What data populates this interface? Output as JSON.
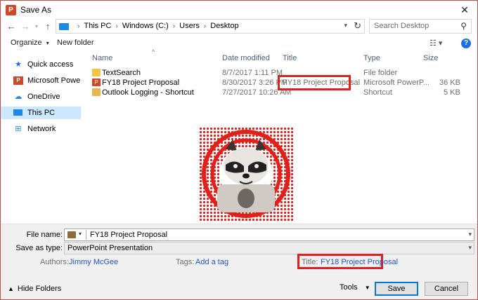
{
  "window": {
    "title": "Save As",
    "app_icon_letter": "P"
  },
  "address": {
    "crumbs": [
      "This PC",
      "Windows (C:)",
      "Users",
      "Desktop"
    ],
    "search_placeholder": "Search Desktop"
  },
  "toolbar": {
    "organize": "Organize",
    "new_folder": "New folder"
  },
  "sidebar": {
    "items": [
      {
        "label": "Quick access",
        "icon": "star-icon"
      },
      {
        "label": "Microsoft PowerPoint",
        "icon": "powerpoint-icon"
      },
      {
        "label": "OneDrive",
        "icon": "cloud-icon"
      },
      {
        "label": "This PC",
        "icon": "computer-icon",
        "selected": true
      },
      {
        "label": "Network",
        "icon": "network-icon"
      }
    ]
  },
  "columns": {
    "name": "Name",
    "date": "Date modified",
    "title": "Title",
    "type": "Type",
    "size": "Size"
  },
  "files": [
    {
      "name": "TextSearch",
      "date": "8/7/2017 1:11 PM",
      "title": "",
      "type": "File folder",
      "size": "",
      "icon": "folder-icon"
    },
    {
      "name": "FY18 Project Proposal",
      "date": "8/30/2017 3:26 PM",
      "title": "FY18 Project Proposal",
      "type": "Microsoft PowerP...",
      "size": "36 KB",
      "icon": "powerpoint-file-icon"
    },
    {
      "name": "Outlook Logging - Shortcut",
      "date": "7/27/2017 10:26 AM",
      "title": "",
      "type": "Shortcut",
      "size": "5 KB",
      "icon": "shortcut-icon"
    }
  ],
  "form": {
    "file_name_label": "File name:",
    "file_name_value": "FY18 Project Proposal",
    "save_type_label": "Save as type:",
    "save_type_value": "PowerPoint Presentation",
    "authors_label": "Authors:",
    "authors_value": "Jimmy McGee",
    "tags_label": "Tags:",
    "tags_value": "Add a tag",
    "title_label": "Title:",
    "title_value": "FY18 Project Proposal"
  },
  "footer": {
    "hide_folders": "Hide Folders",
    "tools": "Tools",
    "save": "Save",
    "cancel": "Cancel"
  },
  "colors": {
    "highlight_box": "#e0201b",
    "selection": "#cce8ff",
    "link": "#1d56c6"
  }
}
